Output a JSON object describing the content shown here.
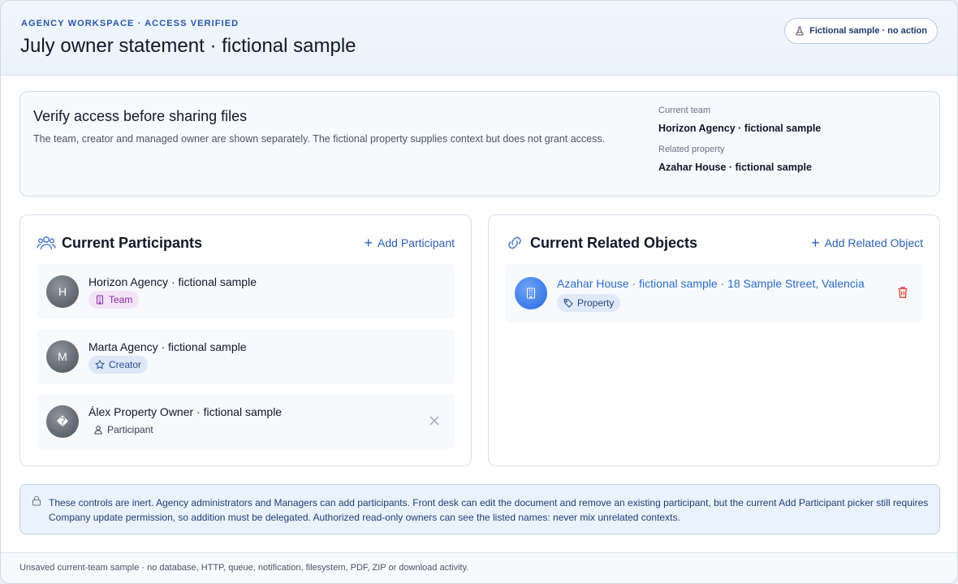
{
  "header": {
    "eyebrow": "AGENCY WORKSPACE · ACCESS VERIFIED",
    "title": "July owner statement · fictional sample",
    "sample_badge": "Fictional sample · no action"
  },
  "verify": {
    "title": "Verify access before sharing files",
    "description": "The team, creator and managed owner are shown separately. The fictional property supplies context but does not grant access.",
    "current_team_label": "Current team",
    "current_team_value": "Horizon Agency · fictional sample",
    "related_property_label": "Related property",
    "related_property_value": "Azahar House · fictional sample"
  },
  "participants": {
    "title": "Current Participants",
    "add_label": "Add Participant",
    "items": [
      {
        "initial": "H",
        "name": "Horizon Agency · fictional sample",
        "role": "Team"
      },
      {
        "initial": "M",
        "name": "Marta Agency · fictional sample",
        "role": "Creator"
      },
      {
        "initial": "�",
        "name": "Álex Property Owner · fictional sample",
        "role": "Participant"
      }
    ]
  },
  "related": {
    "title": "Current Related Objects",
    "add_label": "Add Related Object",
    "items": [
      {
        "name": "Azahar House · fictional sample · 18 Sample Street, Valencia",
        "type": "Property"
      }
    ]
  },
  "notice": {
    "text": "These controls are inert. Agency administrators and Managers can add participants. Front desk can edit the document and remove an existing participant, but the current Add Participant picker still requires Company update permission, so addition must be delegated. Authorized read-only owners can see the listed names: never mix unrelated contexts."
  },
  "footer": {
    "text": "Unsaved current-team sample · no database, HTTP, queue, notification, filesystem, PDF, ZIP or download activity."
  },
  "icons": {
    "sample": "flask-icon",
    "participants": "users-icon",
    "related": "link-icon",
    "add": "plus-icon",
    "team": "building-icon",
    "creator": "star-icon",
    "participant": "user-icon",
    "remove": "close-icon",
    "property": "tag-icon",
    "delete": "trash-icon",
    "notice": "lock-icon"
  },
  "colors": {
    "accent": "#2b5fb3",
    "team_chip": "#f3e3f7",
    "creator_chip": "#dde7f7",
    "delete": "#d9453b",
    "notice_bg": "#eaf2fd"
  }
}
